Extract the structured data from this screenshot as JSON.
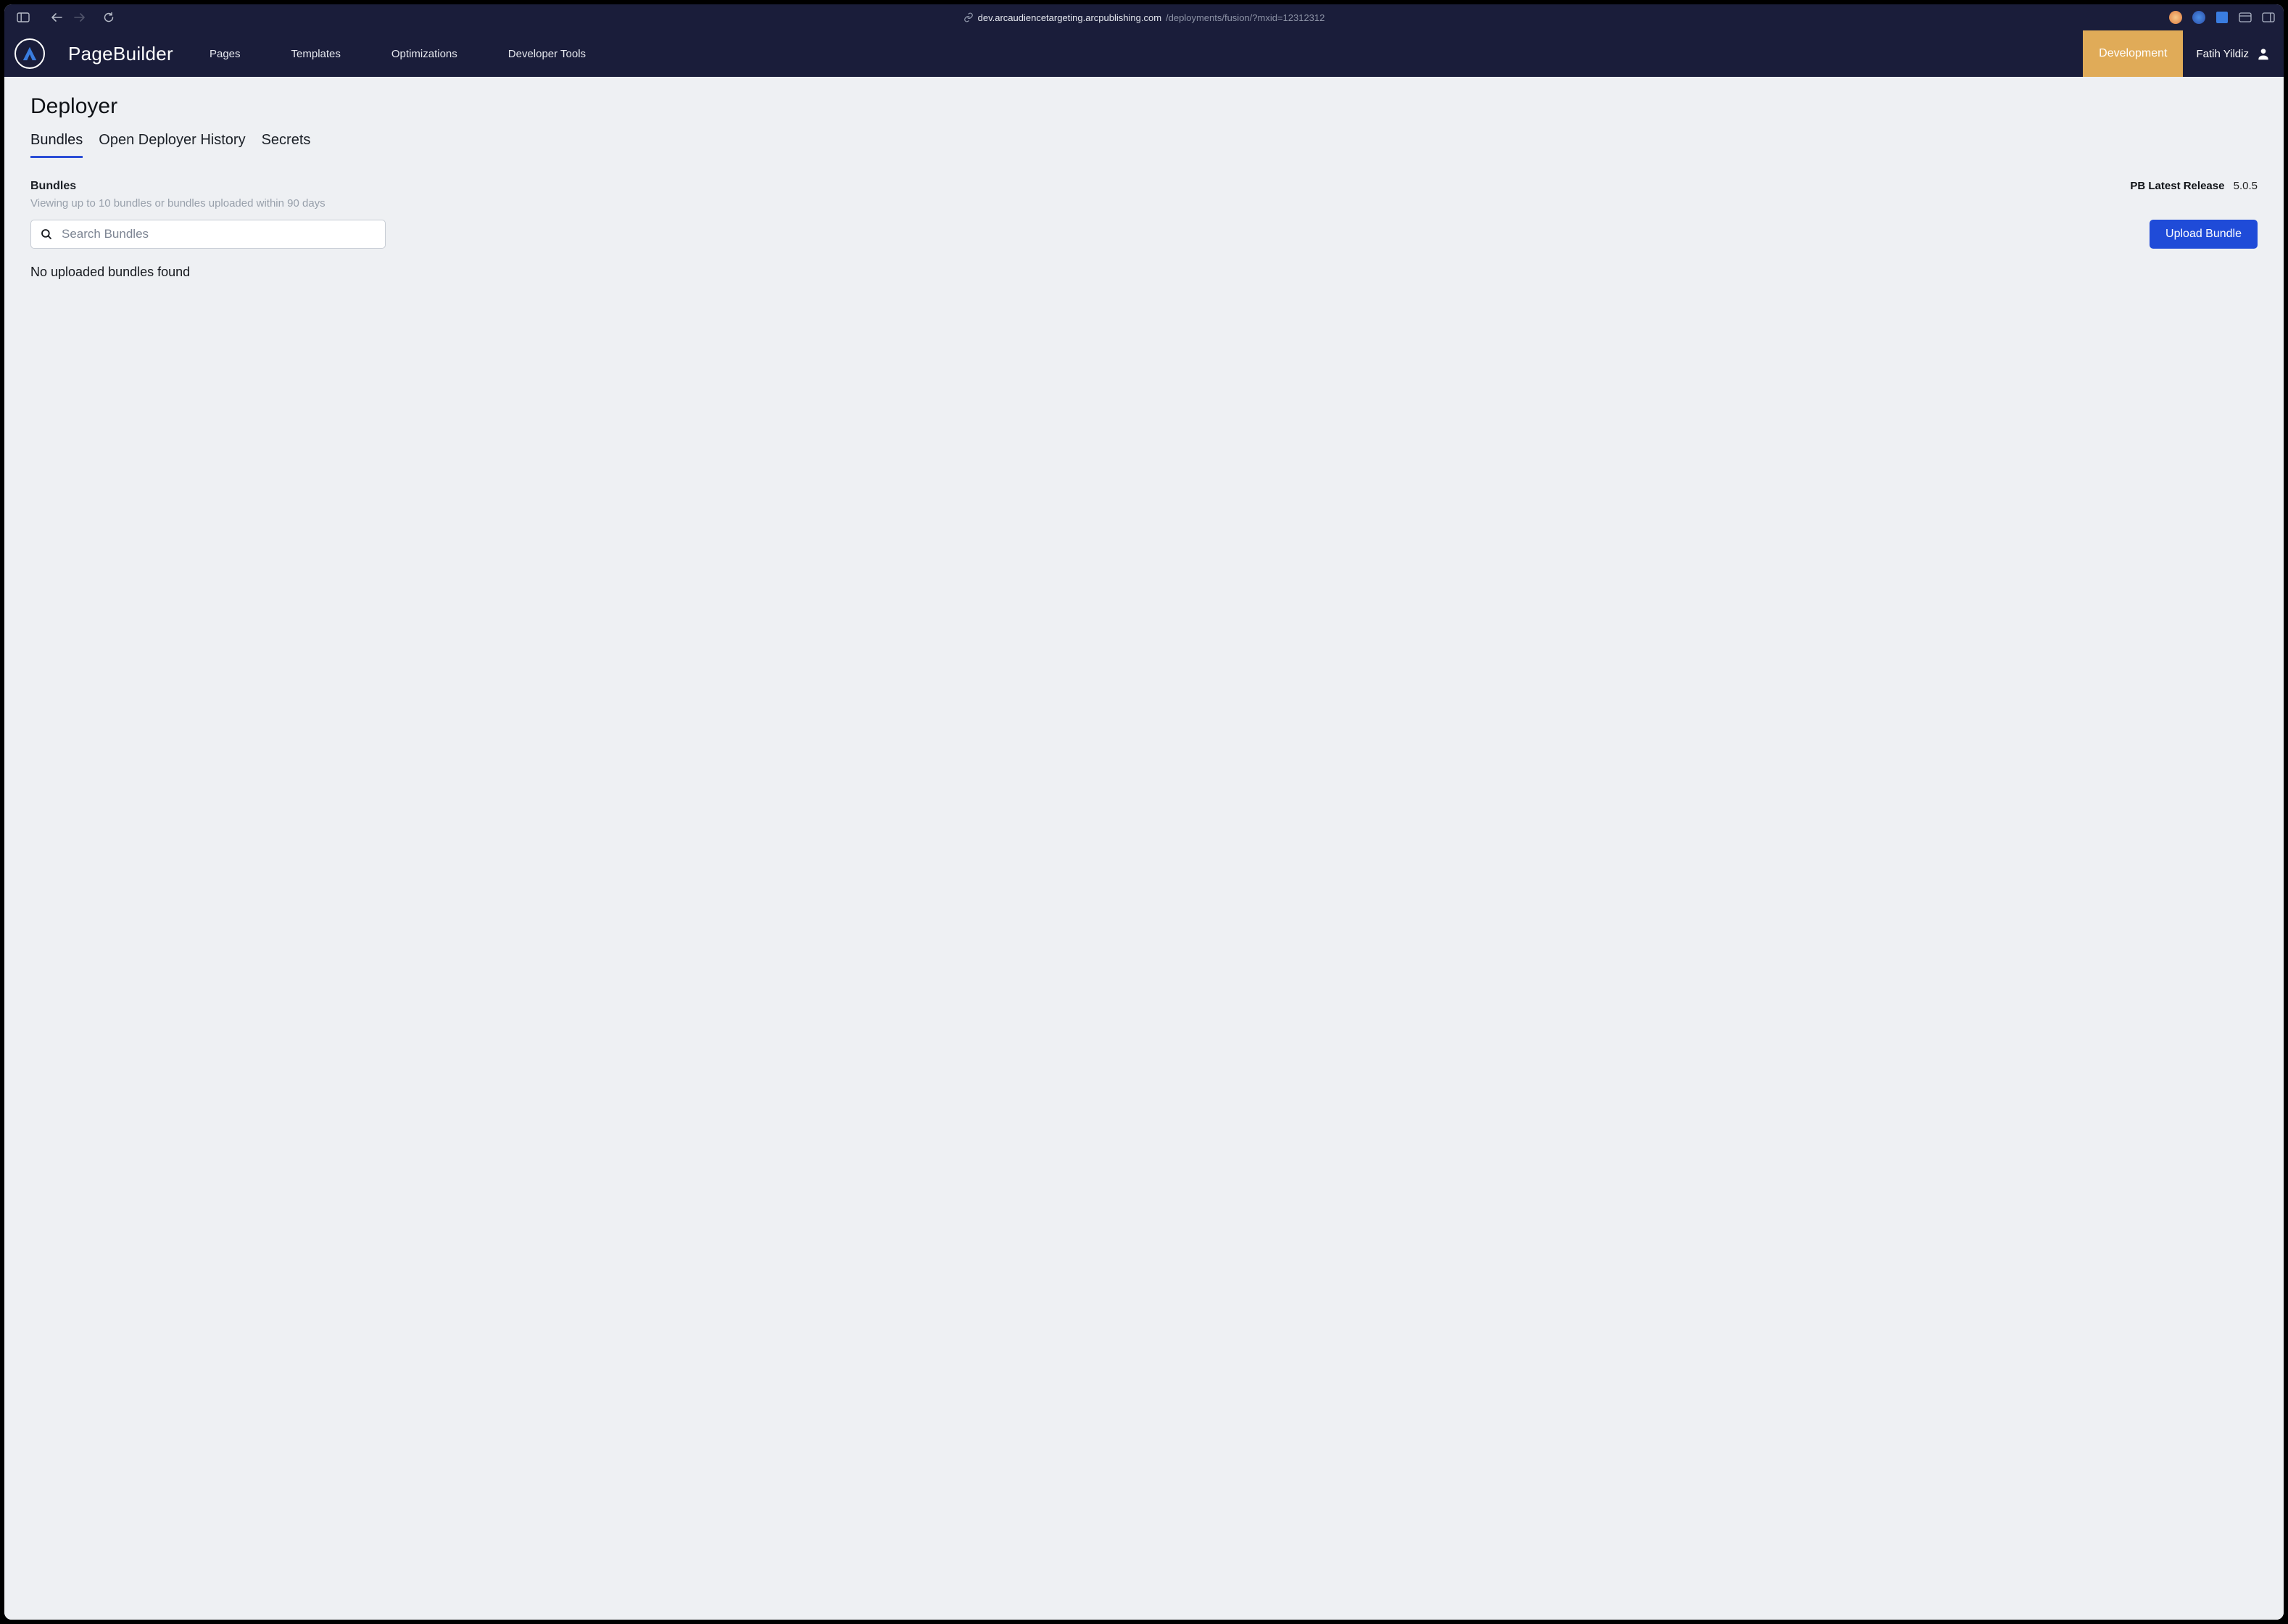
{
  "browser": {
    "url_host": "dev.arcaudiencetargeting.arcpublishing.com",
    "url_path": "/deployments/fusion/?mxid=12312312"
  },
  "header": {
    "app_title": "PageBuilder",
    "nav": {
      "pages": "Pages",
      "templates": "Templates",
      "optimizations": "Optimizations",
      "devtools": "Developer Tools"
    },
    "env_badge": "Development",
    "user_name": "Fatih Yildiz"
  },
  "main": {
    "page_title": "Deployer",
    "tabs": {
      "bundles": "Bundles",
      "history": "Open Deployer History",
      "secrets": "Secrets"
    },
    "section_title": "Bundles",
    "section_subtitle": "Viewing up to 10 bundles or bundles uploaded within 90 days",
    "release_label": "PB Latest Release",
    "release_version": "5.0.5",
    "search_placeholder": "Search Bundles",
    "upload_button": "Upload Bundle",
    "empty_message": "No uploaded bundles found"
  }
}
